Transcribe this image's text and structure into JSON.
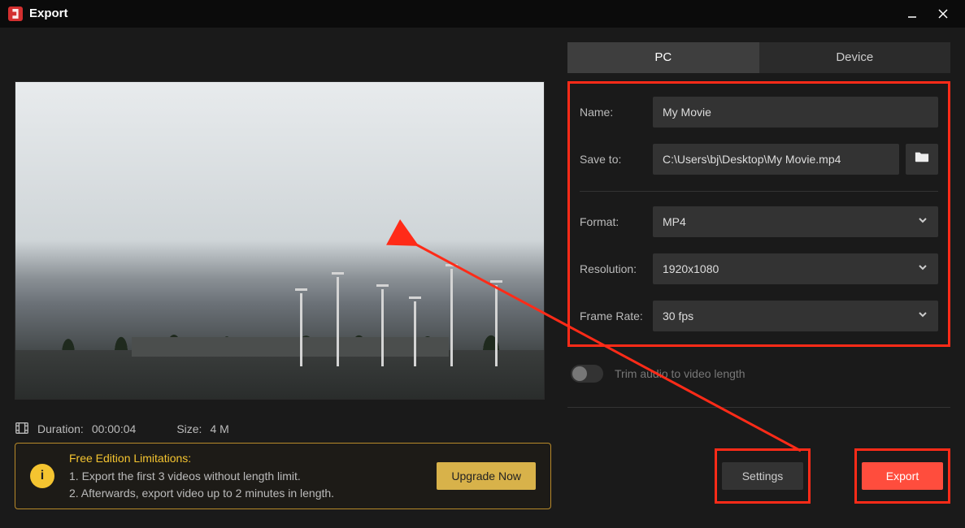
{
  "titlebar": {
    "title": "Export"
  },
  "tabs": {
    "pc": "PC",
    "device": "Device"
  },
  "form": {
    "name_label": "Name:",
    "name_value": "My Movie",
    "save_label": "Save to:",
    "save_value": "C:\\Users\\bj\\Desktop\\My Movie.mp4",
    "format_label": "Format:",
    "format_value": "MP4",
    "resolution_label": "Resolution:",
    "resolution_value": "1920x1080",
    "framerate_label": "Frame Rate:",
    "framerate_value": "30 fps"
  },
  "trim": {
    "label": "Trim audio to video length"
  },
  "meta": {
    "duration_label": "Duration:",
    "duration_value": "00:00:04",
    "size_label": "Size:",
    "size_value": "4 M"
  },
  "limitations": {
    "title": "Free Edition Limitations:",
    "line1": "1. Export the first 3 videos without length limit.",
    "line2": "2. Afterwards, export video up to 2 minutes in length.",
    "upgrade": "Upgrade Now"
  },
  "footer": {
    "settings": "Settings",
    "export": "Export"
  }
}
